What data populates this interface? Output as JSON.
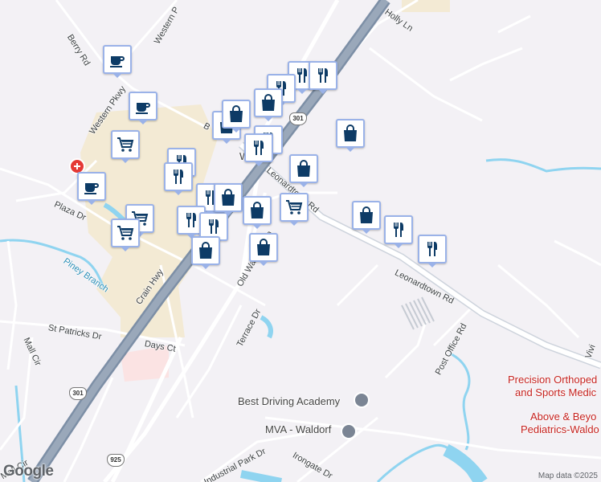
{
  "map": {
    "attribution": "Map data ©2025",
    "provider_logo": "Google",
    "roads": {
      "berry_rd": "Berry Rd",
      "western_pkwy": "Western Pkwy",
      "western_pkwy_top": "Western P",
      "holly_ln": "Holly Ln",
      "plaza_dr": "Plaza Dr",
      "leonardtown_rd_upper": "Leonardtown Rd",
      "leonardtown_rd_lower": "Leonardtown Rd",
      "crain_hwy": "Crain Hwy",
      "old_washington": "Old Washington",
      "st_patricks_dr": "St Patricks Dr",
      "days_ct": "Days Ct",
      "terrace_dr": "Terrace Dr",
      "mall_cir": "Mall Cir",
      "post_office_rd": "Post Office Rd",
      "industrial_park_dr": "Industrial Park Dr",
      "irongate_dr": "Irongate Dr",
      "mall_cir_bottom": "Mall Cir",
      "vivian": "Vivi",
      "b_road": "B",
      "waldorf": "W"
    },
    "water": {
      "piney_branch": "Piney Branch"
    },
    "route_shields": [
      "301",
      "301",
      "925"
    ],
    "places": {
      "best_driving": "Best Driving Academy",
      "mva": "MVA - Waldorf",
      "precision_line1": "Precision Orthoped",
      "precision_line2": "and Sports Medic",
      "above_line1": "Above & Beyo",
      "above_line2": "Pediatrics-Waldo"
    },
    "markers": [
      {
        "type": "coffee"
      },
      {
        "type": "coffee"
      },
      {
        "type": "coffee"
      },
      {
        "type": "restaurant"
      },
      {
        "type": "restaurant"
      },
      {
        "type": "restaurant"
      },
      {
        "type": "restaurant"
      },
      {
        "type": "restaurant"
      },
      {
        "type": "restaurant"
      },
      {
        "type": "restaurant"
      },
      {
        "type": "restaurant"
      },
      {
        "type": "restaurant"
      },
      {
        "type": "restaurant"
      },
      {
        "type": "restaurant"
      },
      {
        "type": "restaurant"
      },
      {
        "type": "shopping-bag"
      },
      {
        "type": "shopping-bag"
      },
      {
        "type": "shopping-bag"
      },
      {
        "type": "shopping-bag"
      },
      {
        "type": "shopping-bag"
      },
      {
        "type": "shopping-bag"
      },
      {
        "type": "shopping-bag"
      },
      {
        "type": "shopping-bag"
      },
      {
        "type": "shopping-bag"
      },
      {
        "type": "shopping-bag"
      },
      {
        "type": "shopping-cart"
      },
      {
        "type": "shopping-cart"
      },
      {
        "type": "shopping-cart"
      },
      {
        "type": "shopping-cart"
      }
    ]
  }
}
